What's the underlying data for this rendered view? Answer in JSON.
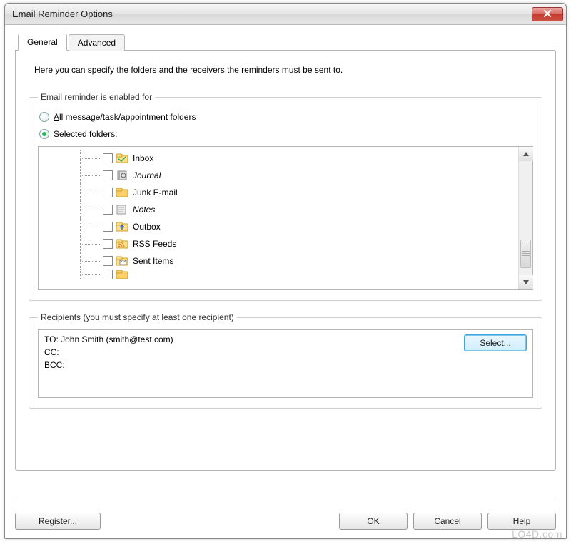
{
  "window": {
    "title": "Email Reminder Options"
  },
  "tabs": {
    "general": "General",
    "advanced": "Advanced"
  },
  "intro": "Here you can specify the folders and the receivers the reminders must be sent to.",
  "group_folders": {
    "legend": "Email reminder is enabled for",
    "radio_all_html": "<u>A</u>ll message/task/appointment folders",
    "radio_selected_html": "<u>S</u>elected folders:",
    "selected": "selected",
    "items": [
      {
        "label": "Inbox",
        "italic": false,
        "icon": "inbox"
      },
      {
        "label": "Journal",
        "italic": true,
        "icon": "journal"
      },
      {
        "label": "Junk E-mail",
        "italic": false,
        "icon": "folder"
      },
      {
        "label": "Notes",
        "italic": true,
        "icon": "notes"
      },
      {
        "label": "Outbox",
        "italic": false,
        "icon": "outbox"
      },
      {
        "label": "RSS Feeds",
        "italic": false,
        "icon": "rss"
      },
      {
        "label": "Sent Items",
        "italic": false,
        "icon": "sent"
      }
    ]
  },
  "group_recipients": {
    "legend": "Recipients (you must specify at least one recipient)",
    "to_line": "TO: John Smith (smith@test.com)",
    "cc_line": "CC:",
    "bcc_line": "BCC:",
    "select_btn": "Select..."
  },
  "buttons": {
    "register": "Register...",
    "ok": "OK",
    "cancel_html": "<u>C</u>ancel",
    "help_html": "<u>H</u>elp"
  },
  "watermark": "LO4D.com"
}
